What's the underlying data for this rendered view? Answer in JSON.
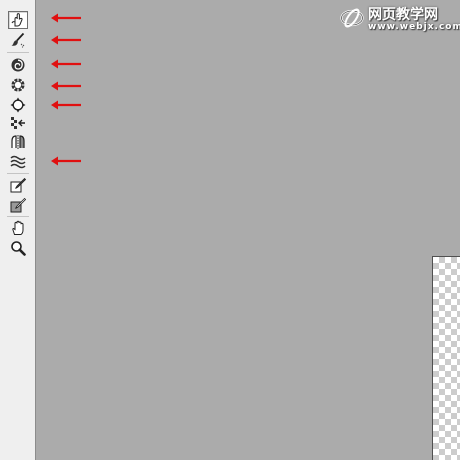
{
  "tools": [
    {
      "name": "forward-warp-tool",
      "icon": "finger-warp-icon",
      "active": true
    },
    {
      "name": "reconstruct-tool",
      "icon": "brush-reconstruct-icon",
      "active": false
    },
    {
      "name": "twirl-clockwise-tool",
      "icon": "twirl-icon",
      "active": false
    },
    {
      "name": "pucker-tool",
      "icon": "pucker-icon",
      "active": false
    },
    {
      "name": "bloat-tool",
      "icon": "bloat-icon",
      "active": false
    },
    {
      "name": "push-left-tool",
      "icon": "push-left-icon",
      "active": false
    },
    {
      "name": "mirror-tool",
      "icon": "mirror-icon",
      "active": false
    },
    {
      "name": "turbulence-tool",
      "icon": "turbulence-icon",
      "active": false
    },
    {
      "name": "freeze-mask-tool",
      "icon": "freeze-mask-icon",
      "active": false
    },
    {
      "name": "thaw-mask-tool",
      "icon": "thaw-mask-icon",
      "active": false
    },
    {
      "name": "hand-tool",
      "icon": "hand-icon",
      "active": false
    },
    {
      "name": "zoom-tool",
      "icon": "zoom-icon",
      "active": false
    }
  ],
  "annotations": {
    "arrow_color": "#e01010",
    "arrows_point_to": [
      "forward-warp-tool",
      "reconstruct-tool",
      "twirl-clockwise-tool",
      "pucker-tool",
      "bloat-tool",
      "turbulence-tool"
    ]
  },
  "watermark": {
    "title": "网页教学网",
    "url": "www.webjx.com"
  },
  "colors": {
    "workspace": "#ababab",
    "toolbar": "#efefef"
  }
}
